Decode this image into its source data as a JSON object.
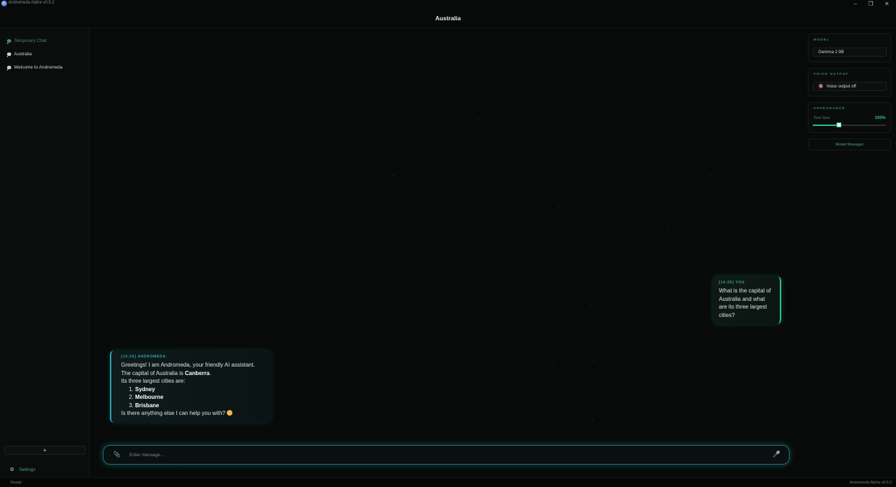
{
  "window": {
    "app_title": "Andromeda Alpha v0.5.2",
    "minimize_glyph": "–",
    "maximize_glyph": "❐",
    "close_glyph": "✕"
  },
  "header": {
    "title": "Australia"
  },
  "sidebar": {
    "items": [
      {
        "label": "Temporary Chat",
        "style": "temporary"
      },
      {
        "label": "Australia",
        "style": "normal"
      },
      {
        "label": "Welcome to Andromeda",
        "style": "normal"
      }
    ],
    "new_chat_label": "+",
    "settings_label": "Settings"
  },
  "chat": {
    "user_message": {
      "meta": "[14:20] YOU",
      "text": "What is the capital of Australia and what are its three largest cities?"
    },
    "assistant_message": {
      "meta": "[14:20] ANDROMEDA",
      "greeting": "Greetings! I am Andromeda, your friendly AI assistant.",
      "capital_prefix": "The capital of Australia is ",
      "capital_name": "Canberra",
      "capital_suffix": ".",
      "cities_intro": "Its three largest cities are:",
      "cities": [
        "Sydney",
        "Melbourne",
        "Brisbane"
      ],
      "closing": "Is there anything else I can help you with?"
    },
    "composer": {
      "placeholder": "Enter message..."
    }
  },
  "right_panel": {
    "model": {
      "label": "MODEL",
      "value": "Gemma 2 9B"
    },
    "voice": {
      "label": "VOICE OUTPUT",
      "value": "Voice output off"
    },
    "appearance": {
      "label": "APPEARANCE",
      "text_size_label": "Text Size",
      "text_size_value": "100%",
      "text_size_fraction": 0.35
    },
    "model_manager_label": "Model Manager"
  },
  "status": {
    "left": "Ready",
    "right": "Andromeda Alpha v0.5.2"
  },
  "colors": {
    "accent_green": "#2fbf8e",
    "accent_cyan": "#2aa8b3"
  },
  "icons": {
    "app": "app-logo-icon",
    "chat_item": "chat-bubble-icon",
    "settings": "gear-icon",
    "attach": "paperclip-icon",
    "mic": "microphone-icon",
    "voice": "speaker-icon"
  }
}
